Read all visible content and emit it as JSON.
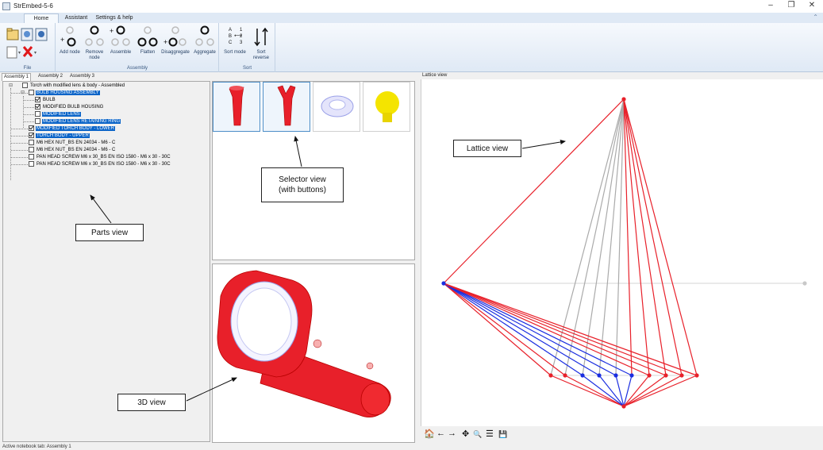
{
  "window": {
    "title": "StrEmbed-5-6",
    "minimize": "–",
    "maximize": "❐",
    "close": "✕"
  },
  "ribbon": {
    "tabs": [
      "Home",
      "Assistant",
      "Settings & help"
    ],
    "groups": {
      "file": "File",
      "assembly": "Assembly",
      "sort": "Sort"
    },
    "buttons": {
      "add_node": "Add node",
      "remove_node": "Remove node",
      "assemble": "Assemble",
      "flatten": "Flatten",
      "disaggregate": "Disaggregate",
      "aggregate": "Aggregate",
      "sort_mode": "Sort mode",
      "sort_reverse": "Sort reverse"
    }
  },
  "panel_tabs": [
    "Assembly 1",
    "Assembly 2",
    "Assembly 3"
  ],
  "tree": {
    "root": "Torch with modified lens & body - Assembled",
    "items": [
      {
        "label": "BULB HOUSING ASSEMBLY",
        "checked": false,
        "selected": true
      },
      {
        "label": "BULB",
        "checked": true,
        "selected": false
      },
      {
        "label": "MODIFIED BULB HOUSING",
        "checked": true,
        "selected": false
      },
      {
        "label": "MODIFIED LENS",
        "checked": false,
        "selected": true
      },
      {
        "label": "MODIFIED LENS RETAINING RING",
        "checked": false,
        "selected": true
      },
      {
        "label": "MODIFIED TORCH BODY - LOWER",
        "checked": true,
        "selected": true
      },
      {
        "label": "TORCH BODY - UPPER",
        "checked": true,
        "selected": true
      },
      {
        "label": "M6 HEX NUT_BS EN 24034 - M6 - C",
        "checked": false,
        "selected": false
      },
      {
        "label": "M6 HEX NUT_BS EN 24034 - M6 - C",
        "checked": false,
        "selected": false
      },
      {
        "label": "PAN HEAD SCREW M6 x 30_BS EN ISO 1580 - M6 x 30 - 30C",
        "checked": false,
        "selected": false
      },
      {
        "label": "PAN HEAD SCREW M6 x 30_BS EN ISO 1580 - M6 x 30 - 30C",
        "checked": false,
        "selected": false
      }
    ]
  },
  "lattice_title": "Lattice view",
  "status": "Active notebook tab: Assembly 1",
  "annotations": {
    "parts": "Parts view",
    "selector": "Selector view\n(with buttons)",
    "lattice": "Lattice view",
    "view3d": "3D view"
  },
  "lattice_toolbar": {
    "home": "🏠",
    "back": "←",
    "forward": "→",
    "pan": "✥",
    "zoom": "🔍",
    "configure": "☰",
    "save": "💾"
  },
  "colors": {
    "selection": "#0a64c8",
    "red_edge": "#e8202a",
    "blue_edge": "#1a2de0",
    "grey_edge": "#aaaaaa"
  }
}
